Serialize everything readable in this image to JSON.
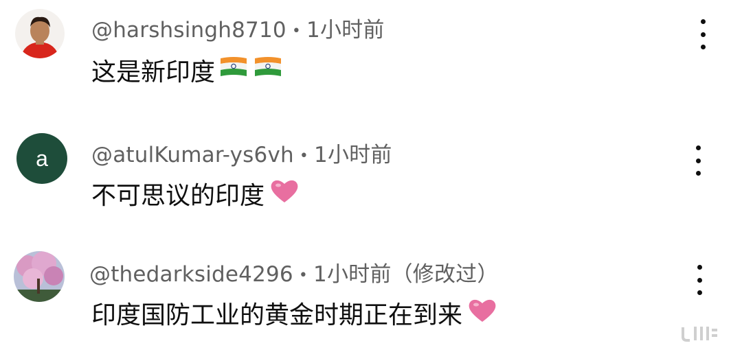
{
  "comments": [
    {
      "handle": "@harshsingh8710",
      "separator": "•",
      "time": "1小时前",
      "edited": "",
      "text": "这是新印度",
      "emoji": [
        "india-flag",
        "india-flag"
      ]
    },
    {
      "handle": "@atulKumar-ys6vh",
      "separator": "•",
      "time": "1小时前",
      "edited": "",
      "avatar_letter": "a",
      "avatar_color": "#1e4d3a",
      "text": "不可思议的印度",
      "emoji": [
        "pink-heart"
      ]
    },
    {
      "handle": "@thedarkside4296",
      "separator": "•",
      "time": "1小时前",
      "edited": "（修改过）",
      "text": "印度国防工业的黄金时期正在到来",
      "emoji": [
        "pink-heart"
      ]
    }
  ],
  "colors": {
    "meta": "#606060",
    "text": "#0f0f0f",
    "heart": "#e86fa0"
  }
}
